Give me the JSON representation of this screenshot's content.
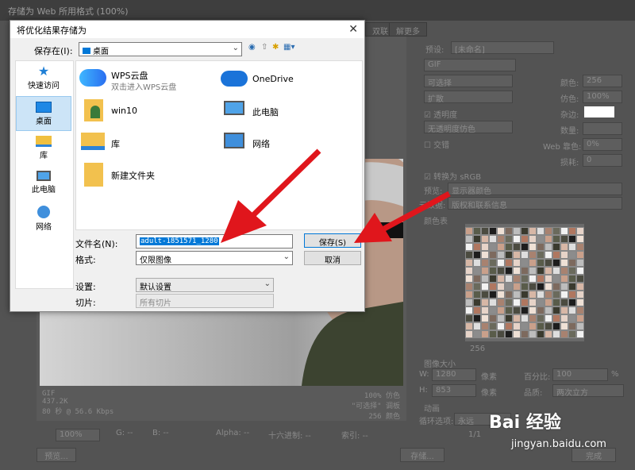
{
  "window": {
    "title": "存储为 Web 所用格式 (100%)",
    "tab_label": "双联",
    "tab2_label": "解更多"
  },
  "right_panel": {
    "preset_label": "预设:",
    "preset_value": "[未命名]",
    "format": "GIF",
    "reduction": "可选择",
    "dither": "扩散",
    "transparency_label": "透明度",
    "matte_value": "无透明度仿色",
    "interlaced_label": "交错",
    "colors_label": "颜色:",
    "colors_value": "256",
    "dither_label": "仿色:",
    "dither_value": "100%",
    "matte_label": "杂边:",
    "amount_label": "数量:",
    "web_snap_label": "Web 靠色:",
    "web_snap_value": "0%",
    "lossy_label": "损耗:",
    "lossy_value": "0",
    "convert_label": "转换为 sRGB",
    "preview_label": "预览:",
    "preview_value": "显示器颜色",
    "metadata_label": "元数据:",
    "metadata_value": "版权和联系信息",
    "color_table_title": "颜色表",
    "color_count": "256",
    "image_size_title": "图像大小",
    "w_label": "W:",
    "w_value": "1280",
    "h_label": "H:",
    "h_value": "853",
    "unit_px": "像素",
    "percent_label": "百分比:",
    "percent_value": "100",
    "percent_unit": "%",
    "quality_label": "品质:",
    "quality_value": "两次立方",
    "animation_title": "动画",
    "loop_label": "循环选项:",
    "loop_value": "永远",
    "frame_value": "1/1"
  },
  "status": {
    "line1_left": "GIF",
    "line2_left": "437.2K",
    "line3_left": "80 秒 @ 56.6 Kbps",
    "line1_right": "100% 仿色",
    "line2_right": "\"可选择\" 调板",
    "line3_right": "256 颜色"
  },
  "bottom_bar": {
    "zoom": "100%",
    "g": "G: --",
    "b": "B: --",
    "alpha": "Alpha: --",
    "hex": "十六进制: --",
    "index": "索引: --",
    "preview_btn": "预览...",
    "save_btn": "存储...",
    "done_btn": "完成"
  },
  "dialog": {
    "title": "将优化结果存储为",
    "save_in_label": "保存在(I):",
    "save_in_value": "桌面",
    "sidebar": [
      {
        "label": "快速访问",
        "icon": "star-icon"
      },
      {
        "label": "桌面",
        "icon": "desktop-icon"
      },
      {
        "label": "库",
        "icon": "library-icon"
      },
      {
        "label": "此电脑",
        "icon": "computer-icon"
      },
      {
        "label": "网络",
        "icon": "network-icon"
      }
    ],
    "files": [
      {
        "name": "WPS云盘",
        "sub": "双击进入WPS云盘",
        "icon": "cloud-icon"
      },
      {
        "name": "OneDrive",
        "sub": "",
        "icon": "cloud-icon"
      },
      {
        "name": "win10",
        "sub": "",
        "icon": "user-folder-icon"
      },
      {
        "name": "此电脑",
        "sub": "",
        "icon": "computer-icon"
      },
      {
        "name": "库",
        "sub": "",
        "icon": "library-icon"
      },
      {
        "name": "网络",
        "sub": "",
        "icon": "network-icon"
      },
      {
        "name": "新建文件夹",
        "sub": "",
        "icon": "folder-icon"
      }
    ],
    "filename_label": "文件名(N):",
    "filename_value": "adult-1851571_1280",
    "format_label": "格式:",
    "format_value": "仅限图像",
    "settings_label": "设置:",
    "settings_value": "默认设置",
    "slices_label": "切片:",
    "slices_value": "所有切片",
    "save_button": "保存(S)",
    "cancel_button": "取消"
  },
  "watermark": {
    "brand": "Bai 经验",
    "url": "jingyan.baidu.com"
  },
  "colors": {
    "accent": "#0078d7",
    "arrow": "#e0161c",
    "selection": "#0078d7"
  }
}
